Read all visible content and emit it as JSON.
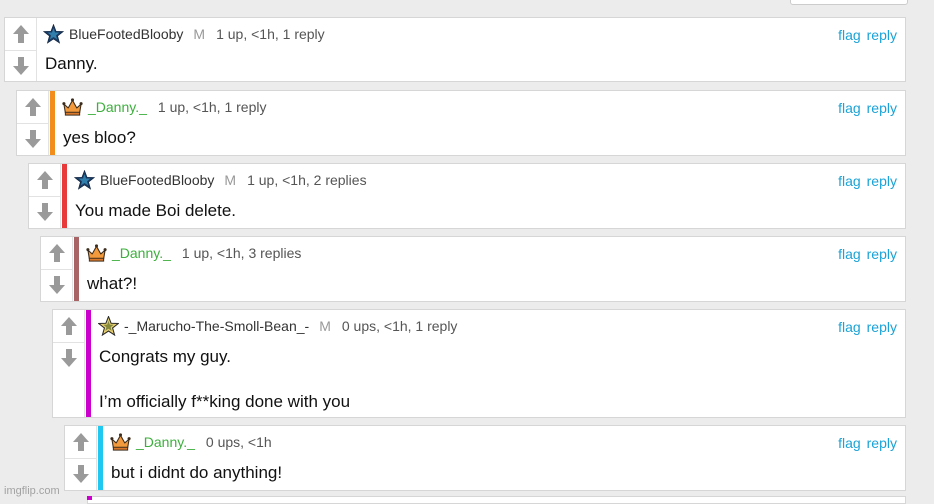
{
  "comments": [
    {
      "username": "BlueFootedBlooby",
      "mod": "M",
      "info": "1 up, <1h, 1 reply",
      "lines": [
        "Danny."
      ],
      "flag": "flag",
      "reply": "reply",
      "badge": "star-icon"
    },
    {
      "username": "_Danny._",
      "mod": "",
      "info": "1 up, <1h, 1 reply",
      "lines": [
        "yes bloo?"
      ],
      "flag": "flag",
      "reply": "reply",
      "badge": "crown-icon",
      "bar_color": "#f28c1a"
    },
    {
      "username": "BlueFootedBlooby",
      "mod": "M",
      "info": "1 up, <1h, 2 replies",
      "lines": [
        "You made Boi delete."
      ],
      "flag": "flag",
      "reply": "reply",
      "badge": "star-icon",
      "bar_color": "#e83a3a"
    },
    {
      "username": "_Danny._",
      "mod": "",
      "info": "1 up, <1h, 3 replies",
      "lines": [
        "what?!"
      ],
      "flag": "flag",
      "reply": "reply",
      "badge": "crown-icon",
      "bar_color": "#a86464"
    },
    {
      "username": "-_Marucho-The-Smoll-Bean_-",
      "mod": "M",
      "info": "0 ups, <1h, 1 reply",
      "lines": [
        "Congrats my guy.",
        "I’m officially f**king done with you"
      ],
      "flag": "flag",
      "reply": "reply",
      "badge": "gold-star-icon",
      "bar_color": "#cc00cc"
    },
    {
      "username": "_Danny._",
      "mod": "",
      "info": "0 ups, <1h",
      "lines": [
        "but i didnt do anything!"
      ],
      "flag": "flag",
      "reply": "reply",
      "badge": "crown-icon",
      "bar_color": "#1ec8f0"
    }
  ],
  "colors": {
    "link": "#1aa3d7",
    "username_green": "#3daf3d",
    "arrow": "#9a9a9a"
  },
  "watermark": "imgflip.com"
}
